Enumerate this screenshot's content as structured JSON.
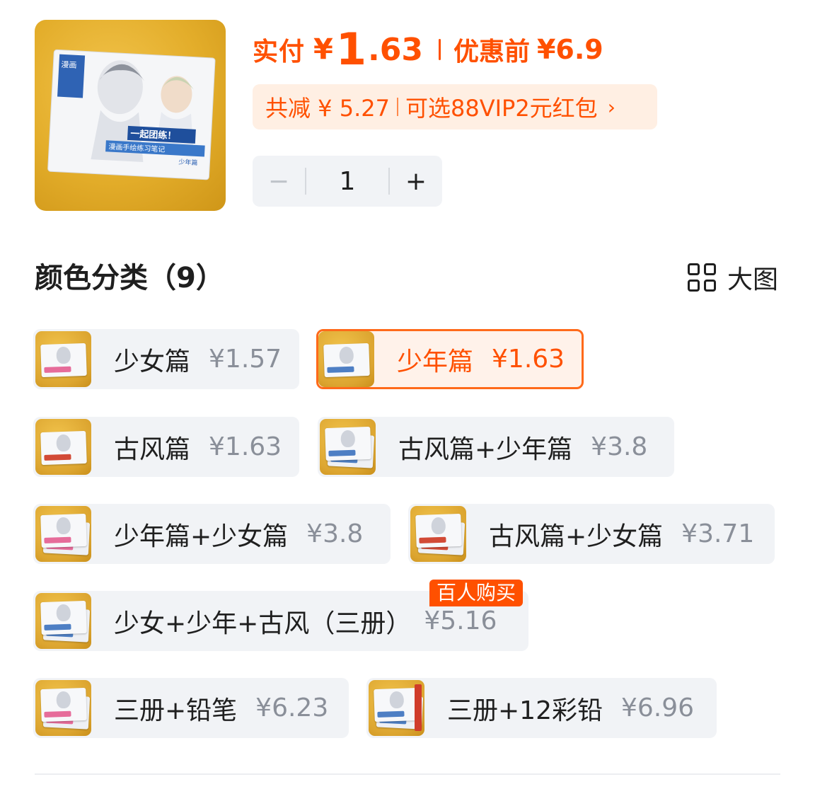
{
  "header": {
    "paid_label": "实付",
    "currency": "¥",
    "paid_int": "1",
    "paid_dec": ".63",
    "original_label": "优惠前",
    "original_price": "¥6.9",
    "promo_discount": "共减 ¥ 5.27",
    "promo_offer": "可选88VIP2元红包",
    "promo_chevron": "›"
  },
  "quantity": {
    "minus": "−",
    "value": "1",
    "plus": "+"
  },
  "section": {
    "title": "颜色分类（9）",
    "big_image_label": "大图"
  },
  "options": [
    {
      "name": "少女篇",
      "price": "¥1.57",
      "selected": false
    },
    {
      "name": "少年篇",
      "price": "¥1.63",
      "selected": true
    },
    {
      "name": "古风篇",
      "price": "¥1.63",
      "selected": false
    },
    {
      "name": "古风篇+少年篇",
      "price": "¥3.8",
      "selected": false
    },
    {
      "name": "少年篇+少女篇",
      "price": "¥3.8",
      "selected": false
    },
    {
      "name": "古风篇+少女篇",
      "price": "¥3.71",
      "selected": false
    },
    {
      "name": "少女+少年+古风（三册）",
      "price": "¥5.16",
      "selected": false,
      "badge": "百人购买"
    },
    {
      "name": "三册+铅笔",
      "price": "¥6.23",
      "selected": false
    },
    {
      "name": "三册+12彩铅",
      "price": "¥6.96",
      "selected": false
    }
  ],
  "product_image": {
    "cover_title": "漫画",
    "cover_line1": "一起团练！",
    "cover_line2": "漫画手绘练习笔记",
    "cover_tag": "少年篇"
  },
  "colors": {
    "accent": "#ff5000",
    "chip_bg": "#f1f3f6",
    "promo_bg": "#ffefe3"
  }
}
